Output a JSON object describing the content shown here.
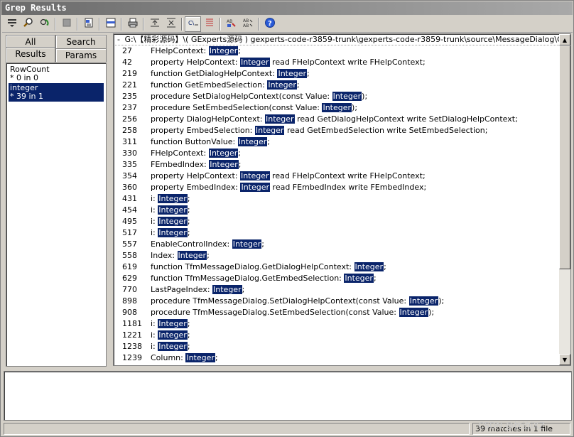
{
  "window": {
    "title": "Grep Results"
  },
  "toolbar": {
    "buttons": [
      "menu-icon",
      "search-icon",
      "refresh-icon",
      "stop-icon",
      "print-preview-icon",
      "show-full-icon",
      "print-icon",
      "expand-all-icon",
      "contract-all-icon",
      "show-context-icon",
      "goto-match-icon",
      "replace-selected-icon",
      "replace-all-icon",
      "help-icon"
    ]
  },
  "left_panel": {
    "tabs": {
      "all": "All",
      "search": "Search",
      "results": "Results",
      "params": "Params"
    },
    "searches": [
      {
        "name": "RowCount",
        "summary": "* 0 in 0"
      },
      {
        "name": "integer",
        "summary": "* 39 in 1"
      }
    ]
  },
  "results": {
    "file_path": "G:\\【精彩源码】\\( GExperts源码 ) gexperts-code-r3859-trunk\\gexperts-code-r3859-trunk\\source\\MessageDialog\\GX_MessageDialog.pas",
    "lines": [
      {
        "num": "27",
        "pre": "FHelpContext: ",
        "match": "Integer",
        "post": ";"
      },
      {
        "num": "42",
        "pre": "property HelpContext: ",
        "match": "Integer",
        "post": " read FHelpContext write FHelpContext;"
      },
      {
        "num": "219",
        "pre": "function GetDialogHelpContext: ",
        "match": "Integer",
        "post": ";"
      },
      {
        "num": "221",
        "pre": "function GetEmbedSelection: ",
        "match": "Integer",
        "post": ";"
      },
      {
        "num": "235",
        "pre": "procedure SetDialogHelpContext(const Value: ",
        "match": "Integer",
        "post": ");"
      },
      {
        "num": "237",
        "pre": "procedure SetEmbedSelection(const Value: ",
        "match": "Integer",
        "post": ");"
      },
      {
        "num": "256",
        "pre": "property DialogHelpContext: ",
        "match": "Integer",
        "post": " read GetDialogHelpContext write SetDialogHelpContext;"
      },
      {
        "num": "258",
        "pre": "property EmbedSelection: ",
        "match": "Integer",
        "post": " read GetEmbedSelection write SetEmbedSelection;"
      },
      {
        "num": "311",
        "pre": "function ButtonValue: ",
        "match": "Integer",
        "post": ";"
      },
      {
        "num": "330",
        "pre": "FHelpContext: ",
        "match": "Integer",
        "post": ";"
      },
      {
        "num": "335",
        "pre": "FEmbedIndex: ",
        "match": "Integer",
        "post": ";"
      },
      {
        "num": "354",
        "pre": "property HelpContext: ",
        "match": "Integer",
        "post": " read FHelpContext write FHelpContext;"
      },
      {
        "num": "360",
        "pre": "property EmbedIndex: ",
        "match": "Integer",
        "post": " read FEmbedIndex write FEmbedIndex;"
      },
      {
        "num": "431",
        "pre": "i: ",
        "match": "Integer",
        "post": ";"
      },
      {
        "num": "454",
        "pre": "i: ",
        "match": "Integer",
        "post": ";"
      },
      {
        "num": "495",
        "pre": "i: ",
        "match": "Integer",
        "post": ";"
      },
      {
        "num": "517",
        "pre": "i: ",
        "match": "Integer",
        "post": ";"
      },
      {
        "num": "557",
        "pre": "EnableControlIndex: ",
        "match": "Integer",
        "post": ";"
      },
      {
        "num": "558",
        "pre": "Index: ",
        "match": "Integer",
        "post": ";"
      },
      {
        "num": "619",
        "pre": "function TfmMessageDialog.GetDialogHelpContext: ",
        "match": "Integer",
        "post": ";"
      },
      {
        "num": "629",
        "pre": "function TfmMessageDialog.GetEmbedSelection: ",
        "match": "Integer",
        "post": ";"
      },
      {
        "num": "770",
        "pre": "LastPageIndex: ",
        "match": "Integer",
        "post": ";"
      },
      {
        "num": "898",
        "pre": "procedure TfmMessageDialog.SetDialogHelpContext(const Value: ",
        "match": "Integer",
        "post": ");"
      },
      {
        "num": "908",
        "pre": "procedure TfmMessageDialog.SetEmbedSelection(const Value: ",
        "match": "Integer",
        "post": ");"
      },
      {
        "num": "1181",
        "pre": "i: ",
        "match": "Integer",
        "post": ";"
      },
      {
        "num": "1221",
        "pre": "i: ",
        "match": "Integer",
        "post": ";"
      },
      {
        "num": "1238",
        "pre": "i: ",
        "match": "Integer",
        "post": ";"
      },
      {
        "num": "1239",
        "pre": "Column: ",
        "match": "Integer",
        "post": ";"
      }
    ]
  },
  "statusbar": {
    "matches": "39 matches in 1 file"
  },
  "watermark": "CSDN @枕边iXZ",
  "colors": {
    "selection": "#0a246a",
    "face": "#d4d0c8"
  }
}
